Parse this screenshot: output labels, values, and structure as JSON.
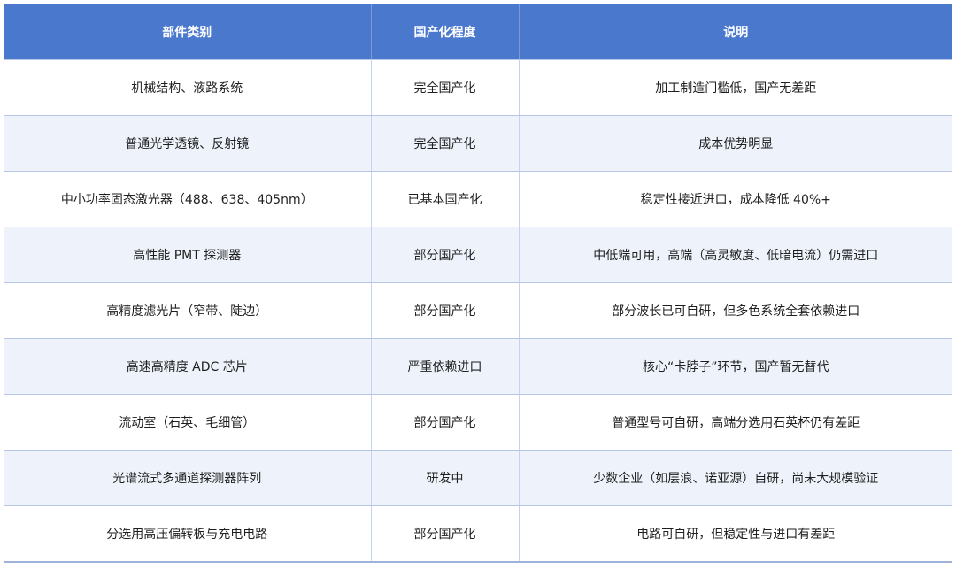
{
  "table": {
    "headers": [
      "部件类别",
      "国产化程度",
      "说明"
    ],
    "rows": [
      [
        "机械结构、液路系统",
        "完全国产化",
        "加工制造门槛低，国产无差距"
      ],
      [
        "普通光学透镜、反射镜",
        "完全国产化",
        "成本优势明显"
      ],
      [
        "中小功率固态激光器（488、638、405nm）",
        "已基本国产化",
        "稳定性接近进口，成本降低 40%+"
      ],
      [
        "高性能 PMT 探测器",
        "部分国产化",
        "中低端可用，高端（高灵敏度、低暗电流）仍需进口"
      ],
      [
        "高精度滤光片（窄带、陡边）",
        "部分国产化",
        "部分波长已可自研，但多色系统全套依赖进口"
      ],
      [
        "高速高精度 ADC 芯片",
        "严重依赖进口",
        "核心“卡脖子”环节，国产暂无替代"
      ],
      [
        "流动室（石英、毛细管）",
        "部分国产化",
        "普通型号可自研，高端分选用石英杯仍有差距"
      ],
      [
        "光谱流式多通道探测器阵列",
        "研发中",
        "少数企业（如层浪、诺亚源）自研，尚未大规模验证"
      ],
      [
        "分选用高压偏转板与充电电路",
        "部分国产化",
        "电路可自研，但稳定性与进口有差距"
      ]
    ]
  },
  "colors": {
    "header_bg": "#4a78cc",
    "row_alt_bg": "#eef3fb",
    "grid_line": "#b7c6e6"
  }
}
